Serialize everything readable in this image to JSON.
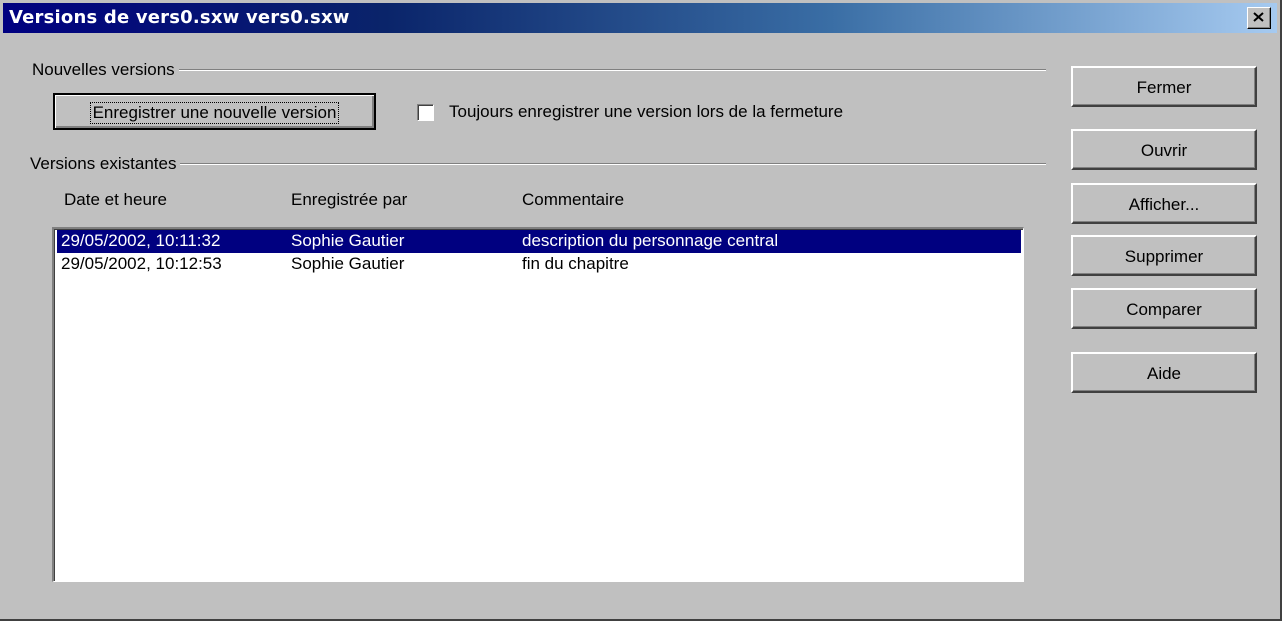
{
  "window": {
    "title": "Versions de vers0.sxw vers0.sxw"
  },
  "new_versions": {
    "group_label": "Nouvelles versions",
    "save_button_label": "Enregistrer une nouvelle version",
    "always_save_label": "Toujours enregistrer une version lors de la fermeture",
    "always_save_checked": false
  },
  "existing_versions": {
    "group_label": "Versions existantes",
    "columns": [
      "Date et heure",
      "Enregistrée par",
      "Commentaire"
    ],
    "rows": [
      {
        "date": "29/05/2002, 10:11:32",
        "user": "Sophie Gautier",
        "comment": "description du personnage central",
        "selected": true
      },
      {
        "date": "29/05/2002, 10:12:53",
        "user": "Sophie Gautier",
        "comment": "fin du chapitre",
        "selected": false
      }
    ]
  },
  "buttons": {
    "close": "Fermer",
    "open": "Ouvrir",
    "show": "Afficher...",
    "delete": "Supprimer",
    "compare": "Comparer",
    "help": "Aide"
  },
  "icons": {
    "close": "close-icon"
  },
  "colors": {
    "selection": "#000080",
    "titlebar": "#000080",
    "face": "#c0c0c0"
  }
}
